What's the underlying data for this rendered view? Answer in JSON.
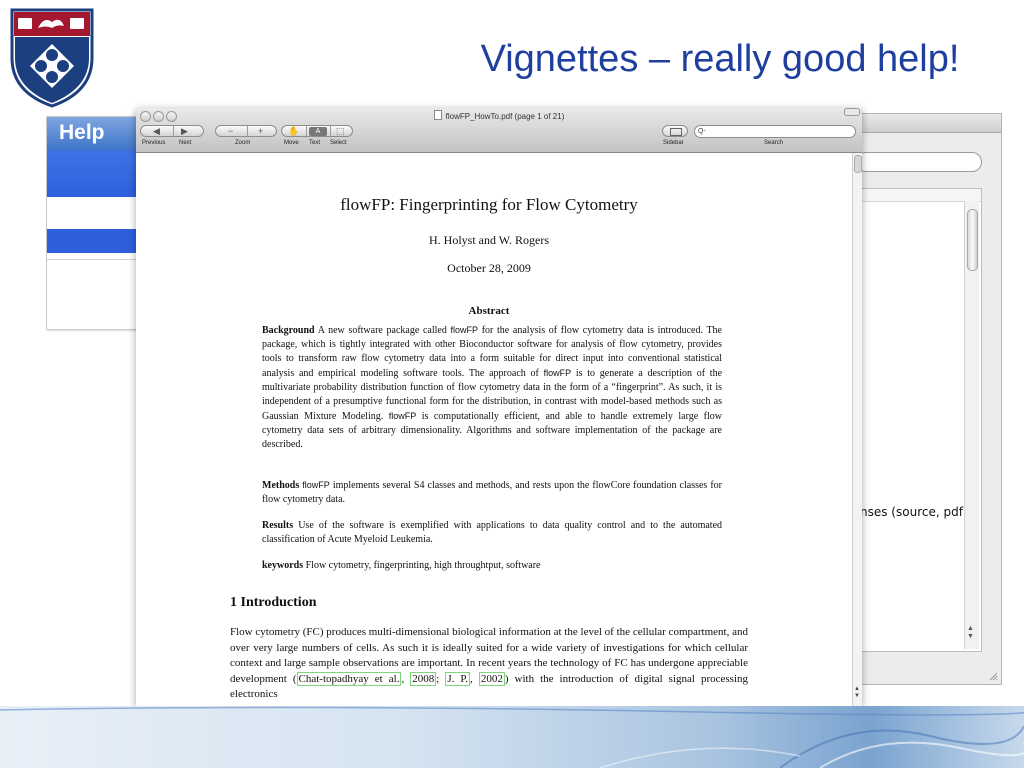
{
  "slide": {
    "title": "Vignettes – really good help!"
  },
  "help_window": {
    "header": "Help"
  },
  "right_window": {
    "visible_text": "nses (source, pdf)"
  },
  "preview_window": {
    "title": "flowFP_HowTo.pdf (page 1 of 21)",
    "toolbar": {
      "previous": "Previous",
      "next": "Next",
      "zoom": "Zoom",
      "move": "Move",
      "text": "Text",
      "select": "Select",
      "sidebar": "Sidebar",
      "search": "Search",
      "search_placeholder": "Q-"
    }
  },
  "document": {
    "title": "flowFP: Fingerprinting for Flow Cytometry",
    "authors": "H. Holyst and W. Rogers",
    "date": "October 28, 2009",
    "abstract_heading": "Abstract",
    "background_label": "Background",
    "background_text_1": "A new software package called",
    "background_pkg": "flowFP",
    "background_text_2": "for the analysis of flow cytometry data is introduced. The package, which is tightly integrated with other Bioconductor software for analysis of flow cytometry, provides tools to transform raw flow cytometry data into a form suitable for direct input into conventional statistical analysis and empirical modeling software tools. The approach of",
    "background_text_3": "is to generate a description of the multivariate probability distribution function of flow cytometry data in the form of a “fingerprint”. As such, it is independent of a presumptive functional form for the distribution, in contrast with model-based methods such as Gaussian Mixture Modeling.",
    "background_text_4": "is computationally efficient, and able to handle extremely large flow cytometry data sets of arbitrary dimensionality. Algorithms and software implementation of the package are described.",
    "methods_label": "Methods",
    "methods_text": "implements several S4 classes and methods, and rests upon the flowCore foundation classes for flow cytometry data.",
    "results_label": "Results",
    "results_text": "Use of the software is exemplified with applications to data quality control and to the automated classification of Acute Myeloid Leukemia.",
    "keywords_label": "keywords",
    "keywords_text": "Flow cytometry, fingerprinting, high throughtput, software",
    "intro_heading": "1   Introduction",
    "intro_text_1": "Flow cytometry (FC) produces multi-dimensional biological information at the level of the cellular compartment, and over very large numbers of cells. As such it is ideally suited for a wide variety of investigations for which cellular context and large sample observations are important. In recent years the technology of FC has undergone appreciable development (",
    "cite_1": "Chat-topadhyay et al.",
    "cite_2": "2008",
    "cite_3": "J. P.",
    "cite_4": "2002",
    "intro_text_2": ") with the introduction of digital signal processing electronics"
  }
}
